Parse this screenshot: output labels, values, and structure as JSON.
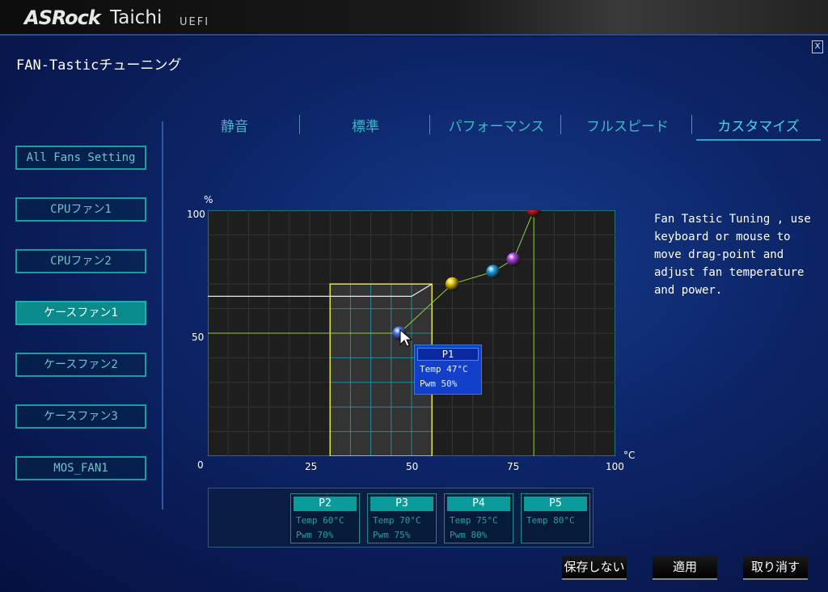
{
  "header": {
    "brand": "ASRock",
    "model": "Taichi",
    "firmware": "UEFI"
  },
  "page": {
    "title": "FAN-Tasticチューニング",
    "close_label": "X"
  },
  "sidebar": {
    "items": [
      {
        "label": "All Fans Setting",
        "active": false
      },
      {
        "label": "CPUファン1",
        "active": false
      },
      {
        "label": "CPUファン2",
        "active": false
      },
      {
        "label": "ケースファン1",
        "active": true
      },
      {
        "label": "ケースファン2",
        "active": false
      },
      {
        "label": "ケースファン3",
        "active": false
      },
      {
        "label": "MOS_FAN1",
        "active": false
      }
    ]
  },
  "tabs": [
    {
      "label": "静音",
      "active": false
    },
    {
      "label": "標準",
      "active": false
    },
    {
      "label": "パフォーマンス",
      "active": false
    },
    {
      "label": "フルスピード",
      "active": false
    },
    {
      "label": "カスタマイズ",
      "active": true
    }
  ],
  "graph": {
    "y_unit": "%",
    "x_unit": "°C",
    "y_ticks": [
      "0",
      "50",
      "100"
    ],
    "x_ticks": [
      "25",
      "50",
      "75",
      "100"
    ]
  },
  "chart_data": {
    "type": "line",
    "xlim": [
      0,
      100
    ],
    "ylim": [
      0,
      100
    ],
    "xlabel": "°C",
    "ylabel": "%",
    "grid": true,
    "points": [
      {
        "name": "P1",
        "x": 47,
        "y": 50,
        "color": "#4a70e8"
      },
      {
        "name": "P2",
        "x": 60,
        "y": 70,
        "color": "#e8c800"
      },
      {
        "name": "P3",
        "x": 70,
        "y": 75,
        "color": "#20a0e0"
      },
      {
        "name": "P4",
        "x": 75,
        "y": 80,
        "color": "#b040e0"
      },
      {
        "name": "P5",
        "x": 80,
        "y": 100,
        "color": "#e01818"
      }
    ],
    "selection": {
      "x_min": 30,
      "x_max": 55,
      "y_min": 0,
      "y_max": 70
    },
    "ghost_curve": [
      [
        0,
        65
      ],
      [
        50,
        65
      ],
      [
        55,
        70
      ]
    ]
  },
  "tooltip": {
    "title": "P1",
    "temp": "Temp 47°C",
    "pwm": "Pwm  50%"
  },
  "point_boxes": [
    {
      "title": "P2",
      "temp": "Temp 60°C",
      "pwm": "Pwm  70%"
    },
    {
      "title": "P3",
      "temp": "Temp 70°C",
      "pwm": "Pwm  75%"
    },
    {
      "title": "P4",
      "temp": "Temp 75°C",
      "pwm": "Pwm  80%"
    },
    {
      "title": "P5",
      "temp": "Temp 80°C",
      "pwm": ""
    }
  ],
  "help": {
    "text": "Fan Tastic Tuning , use\nkeyboard or mouse to\nmove drag-point and\nadjust fan temperature\nand power."
  },
  "actions": {
    "discard": "保存しない",
    "apply": "適用",
    "cancel": "取り消す"
  }
}
